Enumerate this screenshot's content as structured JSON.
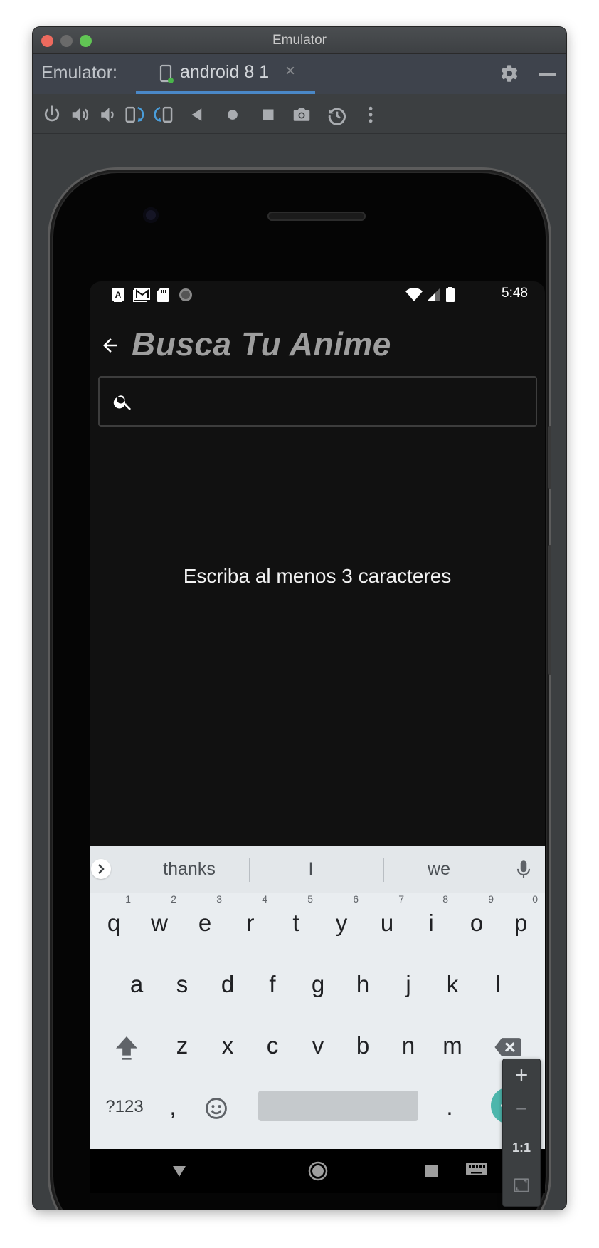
{
  "window": {
    "title": "Emulator"
  },
  "tabbar": {
    "label": "Emulator:",
    "tab_name": "android 8 1",
    "close_glyph": "×"
  },
  "toolbar": {
    "icons": [
      "power-icon",
      "volume-up-icon",
      "volume-down-icon",
      "rotate-left-icon",
      "rotate-right-icon",
      "back-icon",
      "home-icon",
      "overview-icon",
      "screenshot-icon",
      "snapshot-icon",
      "more-icon"
    ]
  },
  "statusbar": {
    "time": "5:48"
  },
  "app": {
    "title": "Busca Tu Anime",
    "search_value": "",
    "hint": "Escriba al menos 3 caracteres"
  },
  "keyboard": {
    "suggestions": [
      "thanks",
      "I",
      "we"
    ],
    "row1": [
      {
        "k": "q",
        "n": "1"
      },
      {
        "k": "w",
        "n": "2"
      },
      {
        "k": "e",
        "n": "3"
      },
      {
        "k": "r",
        "n": "4"
      },
      {
        "k": "t",
        "n": "5"
      },
      {
        "k": "y",
        "n": "6"
      },
      {
        "k": "u",
        "n": "7"
      },
      {
        "k": "i",
        "n": "8"
      },
      {
        "k": "o",
        "n": "9"
      },
      {
        "k": "p",
        "n": "0"
      }
    ],
    "row2": [
      "a",
      "s",
      "d",
      "f",
      "g",
      "h",
      "j",
      "k",
      "l"
    ],
    "row3": [
      "z",
      "x",
      "c",
      "v",
      "b",
      "n",
      "m"
    ],
    "row4": {
      "symbols": "?123",
      "comma": ",",
      "period": "."
    }
  },
  "zoom": {
    "plus": "+",
    "minus": "−",
    "ratio": "1:1"
  },
  "colors": {
    "accent": "#4db6ac",
    "tab_underline": "#4a88c7",
    "title": "#9e9e9e"
  }
}
